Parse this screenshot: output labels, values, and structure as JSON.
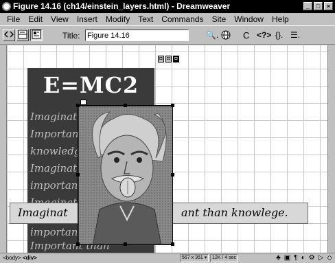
{
  "window": {
    "title": "Figure 14.16 (ch14/einstein_layers.html) - Dreamweaver",
    "controls": [
      "_",
      "□",
      "×"
    ]
  },
  "menu": [
    "File",
    "Edit",
    "View",
    "Insert",
    "Modify",
    "Text",
    "Commands",
    "Site",
    "Window",
    "Help"
  ],
  "toolbar": {
    "title_label": "Title:",
    "title_value": "Figure 14.16",
    "preview_symbol": "🔍.",
    "refresh_symbol": "C",
    "code_symbol": "<?>",
    "braces_symbol": "{}.",
    "options_symbol": "☰."
  },
  "document": {
    "layer_markers": [
      "◘",
      "◘",
      "◘"
    ],
    "emc": {
      "title": "E=MC2",
      "words": [
        "Imaginat",
        "Important",
        "knowledge",
        "Imaginat",
        "important",
        "Imaginat",
        "important",
        "Important than"
      ]
    },
    "quote": {
      "left": "Imaginat",
      "right": "ant than knowlege."
    }
  },
  "statusbar": {
    "tag_body": "<body>",
    "tag_div": "<div>",
    "window_size": "567 x 351 ▾",
    "download": "12K / 4 sec"
  },
  "colors": {
    "titlebar": "#000000",
    "chrome": "#c0c0c0",
    "emc_panel": "#3a3a3a",
    "quote_strip": "#d8d8d8"
  }
}
